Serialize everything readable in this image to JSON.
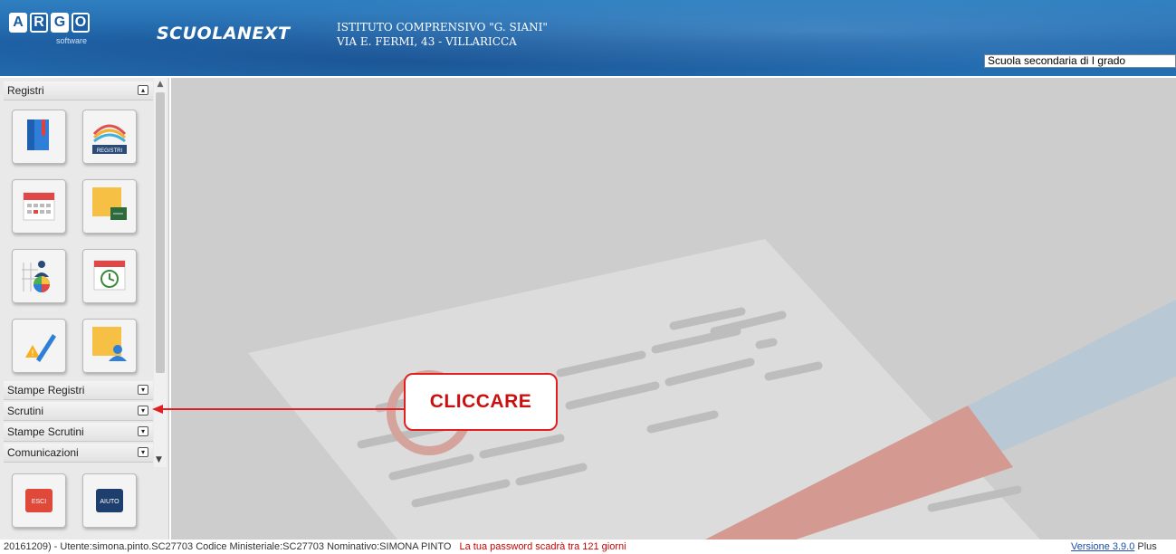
{
  "header": {
    "logo_letters": [
      "A",
      "R",
      "G",
      "O"
    ],
    "logo_sub": "software",
    "brand": "SCUOLANEXT",
    "school_name": "ISTITUTO COMPRENSIVO \"G. SIANI\"",
    "school_address": "VIA E. FERMI, 43 - VILLARICCA",
    "school_type_selected": "Scuola secondaria di I grado"
  },
  "sidebar": {
    "sections": [
      {
        "label": "Registri",
        "state": "open"
      },
      {
        "label": "Stampe Registri",
        "state": "closed"
      },
      {
        "label": "Scrutini",
        "state": "closed"
      },
      {
        "label": "Stampe Scrutini",
        "state": "closed"
      },
      {
        "label": "Comunicazioni",
        "state": "closed"
      }
    ],
    "registri_tiles": [
      {
        "icon": "register-book-icon"
      },
      {
        "icon": "registri-icon",
        "label": "REGISTRI"
      },
      {
        "icon": "calendar-icon"
      },
      {
        "icon": "sticky-note-board-icon"
      },
      {
        "icon": "grid-chart-student-icon"
      },
      {
        "icon": "calendar-clock-icon"
      },
      {
        "icon": "warning-pencil-icon"
      },
      {
        "icon": "sticky-note-user-icon"
      }
    ],
    "bottom_tiles": [
      {
        "icon": "exit-icon",
        "label": "ESCI"
      },
      {
        "icon": "help-icon",
        "label": "AIUTO"
      }
    ]
  },
  "callout": {
    "text": "CLICCARE",
    "color": "#e02020"
  },
  "footer": {
    "info": "20161209) - Utente:simona.pinto.SC27703 Codice Ministeriale:SC27703 Nominativo:SIMONA PINTO",
    "password_warning": "La tua password scadrà tra 121 giorni",
    "version_link": "Versione 3.9.0",
    "version_suffix": "Plus"
  },
  "colors": {
    "header": "#2470b3",
    "warning": "#d00000",
    "callout": "#e02020",
    "link": "#1a4fb0"
  }
}
